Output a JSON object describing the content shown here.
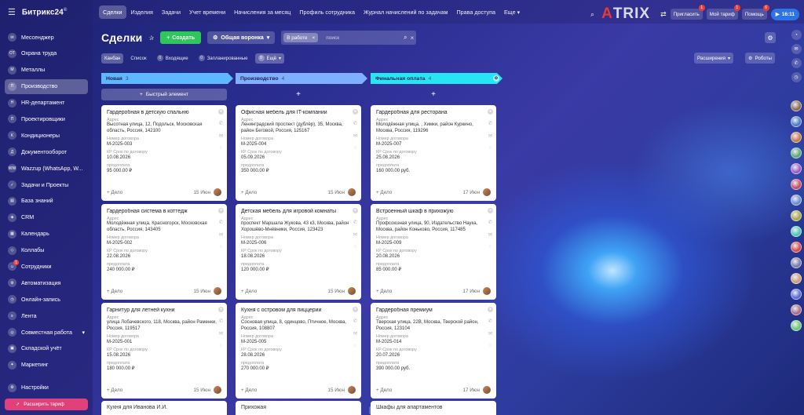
{
  "app": {
    "name": "Битрикс24",
    "version_mark": "©"
  },
  "sidebar": {
    "items": [
      {
        "label": "Мессенджер",
        "icon": "chat-icon",
        "glyph": "✉"
      },
      {
        "label": "Охрана труда",
        "icon": "badge-icon",
        "glyph": "ОТ"
      },
      {
        "label": "Металлы",
        "icon": "badge-icon",
        "glyph": "М"
      },
      {
        "label": "Производство",
        "icon": "badge-icon",
        "glyph": "П",
        "active": true
      },
      {
        "label": "HR-департамент",
        "icon": "badge-icon",
        "glyph": "Н"
      },
      {
        "label": "Проектировщики",
        "icon": "badge-icon",
        "glyph": "П"
      },
      {
        "label": "Кондиционеры",
        "icon": "badge-icon",
        "glyph": "К"
      },
      {
        "label": "Документооборот",
        "icon": "badge-icon",
        "glyph": "Д"
      },
      {
        "label": "Wazzup (WhatsApp, W...",
        "icon": "badge-icon",
        "glyph": "WW"
      },
      {
        "label": "Задачи и Проекты",
        "icon": "tasks-icon",
        "glyph": "✓"
      },
      {
        "label": "База знаний",
        "icon": "book-icon",
        "glyph": "▤"
      },
      {
        "label": "CRM",
        "icon": "crm-icon",
        "glyph": "◈"
      },
      {
        "label": "Календарь",
        "icon": "calendar-icon",
        "glyph": "▦"
      },
      {
        "label": "Коллабы",
        "icon": "collab-icon",
        "glyph": "◇"
      },
      {
        "label": "Сотрудники",
        "icon": "people-icon",
        "glyph": "☺",
        "badge": "1"
      },
      {
        "label": "Автоматизация",
        "icon": "automation-icon",
        "glyph": "⚙"
      },
      {
        "label": "Онлайн-запись",
        "icon": "booking-icon",
        "glyph": "◷"
      },
      {
        "label": "Лента",
        "icon": "feed-icon",
        "glyph": "≡"
      },
      {
        "label": "Совместная работа",
        "icon": "teamwork-icon",
        "glyph": "◎",
        "has_chevron": true
      },
      {
        "label": "Складской учёт",
        "icon": "warehouse-icon",
        "glyph": "▣"
      },
      {
        "label": "Маркетинг",
        "icon": "marketing-icon",
        "glyph": "✦"
      }
    ],
    "settings_label": "Настройки",
    "tariff_label": "Расширить тариф"
  },
  "topnav": {
    "tabs": [
      {
        "label": "Сделки",
        "active": true
      },
      {
        "label": "Изделия"
      },
      {
        "label": "Задачи"
      },
      {
        "label": "Учет времени"
      },
      {
        "label": "Начисления за месяц"
      },
      {
        "label": "Профиль сотрудника"
      },
      {
        "label": "Журнал начислений по задачам"
      },
      {
        "label": "Права доступа"
      },
      {
        "label": "Еще ▾"
      }
    ],
    "invite": "Пригласить",
    "invite_count": "1",
    "tariff": "Мой тариф",
    "tariff_count": "1",
    "help": "Помощь",
    "help_count": "6",
    "time": "16:11",
    "logo_a": "A",
    "logo_rest": "TRIX"
  },
  "toolbar": {
    "title": "Сделки",
    "create": "Создать",
    "funnel": "Общая воронка",
    "filter_chip": "В работе",
    "search_placeholder": "поиск"
  },
  "views": {
    "kanban": "Канбан",
    "list": "Список",
    "incoming": "Входящие",
    "incoming_count": "0",
    "planned": "Запланированные",
    "planned_count": "0",
    "more": "Ещё",
    "more_count": "0",
    "extensions": "Расширения",
    "robots": "Роботы"
  },
  "labels": {
    "address": "Адрес",
    "contract_no": "Номер договора",
    "contract_deadline": "КР Срок по договору",
    "prepayment": "предоплата",
    "deal": "+ Дело",
    "quick_add": "Быстрый элемент",
    "add": "+"
  },
  "columns": [
    {
      "name": "Новая",
      "count": "3",
      "color": "#5db8ff",
      "quick": true,
      "cards": [
        {
          "title": "Гардеробная в детскую спальню",
          "address": "Высотная улица, 12, Подольск, Московская область, Россия, 142100",
          "contract": "М-2025-003",
          "deadline": "10.08.2026",
          "prepay": "95 000.00 ₽",
          "date": "15 Июн"
        },
        {
          "title": "Гардеробная система в коттедж",
          "address": "Молодёжная улица, Красногорск, Московская область, Россия, 143405",
          "contract": "М-2025-002",
          "deadline": "22.08.2026",
          "prepay": "240 000.00 ₽",
          "date": "15 Июн"
        },
        {
          "title": "Гарнитур для летней кухни",
          "address": "улица Лобачевского, 118, Москва, район Раменки, Россия, 119517",
          "contract": "М-2025-001",
          "deadline": "15.08.2026",
          "prepay": "180 000.00 ₽",
          "date": "15 Июн"
        }
      ],
      "peek": "Кухня для Иванова И.И."
    },
    {
      "name": "Производство",
      "count": "4",
      "color": "#7fb0ff",
      "quick": false,
      "cards": [
        {
          "title": "Офисная мебель для IT-компании",
          "address": "Ленинградский проспект (дублёр), 35, Москва, район Беговой, Россия, 125167",
          "contract": "М-2025-004",
          "deadline": "05.09.2026",
          "prepay": "350 000.00 ₽",
          "date": "15 Июн"
        },
        {
          "title": "Детская мебель для игровой комнаты",
          "address": "проспект Маршала Жукова, 43 к3, Москва, район Хорошёво-Мнёвники, Россия, 123423",
          "contract": "М-2025-006",
          "deadline": "18.08.2026",
          "prepay": "120 000.00 ₽",
          "date": "15 Июн"
        },
        {
          "title": "Кухня с островом для пиццерии",
          "address": "Сосновая улица, 8, одинцово, Птичное, Москва, Россия, 108807",
          "contract": "М-2025-005",
          "deadline": "28.08.2026",
          "prepay": "270 000.00 ₽",
          "date": "15 Июн"
        }
      ],
      "peek": "Прихожая"
    },
    {
      "name": "Финальная оплата",
      "count": "4",
      "color": "#25e6f2",
      "quick": false,
      "cards": [
        {
          "title": "Гардеробная для ресторана",
          "address": "Молодёжная улица, , Химки, район Куркино, Москва, Россия, 119296",
          "contract": "М-2025-007",
          "deadline": "25.08.2026",
          "prepay": "160 000.00 руб.",
          "date": "17 Июн"
        },
        {
          "title": "Встроенный шкаф в прихожую",
          "address": "Профсоюзная улица, 90, Издательство Наука, Москва, район Коньково, Россия, 117485",
          "contract": "М-2025-009",
          "deadline": "20.08.2026",
          "prepay": "85 000.00 ₽",
          "date": "17 Июн"
        },
        {
          "title": "Гардеробная премиум",
          "address": "Тверская улица, 22В, Москва, Тверской район, Россия, 123104",
          "contract": "М-2025-014",
          "deadline": "20.07.2026",
          "prepay": "390 000.00 руб.",
          "date": "17 Июн"
        }
      ],
      "peek": "Шкафы для апартаментов"
    }
  ],
  "colors": {
    "create": "#2fc65c",
    "tariff": "#e0417b",
    "clock": "#2c75e8",
    "badge": "#e2403a"
  }
}
